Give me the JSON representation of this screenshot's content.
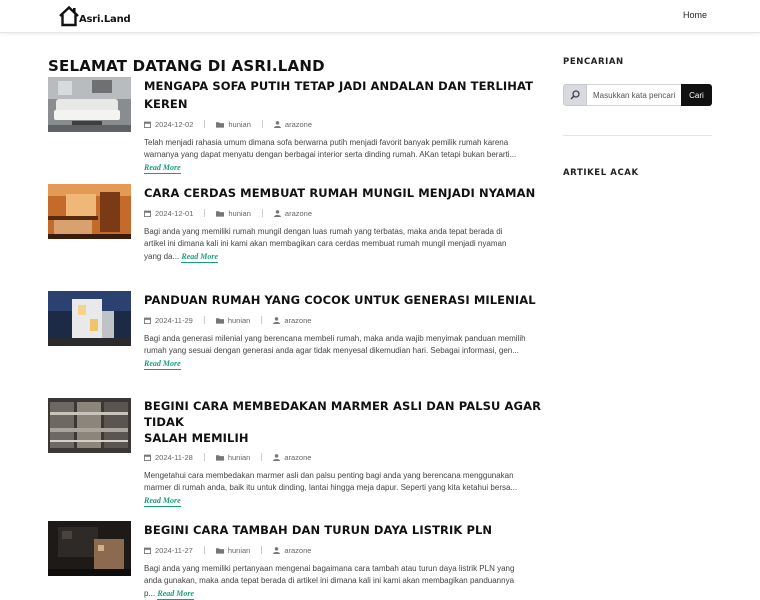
{
  "header": {
    "logo_text": "Asri.Land",
    "nav": {
      "home_label": "Home"
    }
  },
  "main": {
    "title": "SELAMAT DATANG DI ASRI.LAND",
    "read_more_label": "Read More",
    "posts": [
      {
        "title_lines": [
          "MENGAPA SOFA PUTIH TETAP JADI ANDALAN DAN TERLIHAT KEREN"
        ],
        "date": "2024-12-02",
        "category": "hunian",
        "author": "arazone",
        "excerpt_lines": [
          "Telah menjadi rahasia umum dimana sofa berwarna putih menjadi favorit banyak pemilik rumah karena",
          "warnanya yang dapat menyatu dengan berbagai interior serta dinding rumah. AKan tetapi bukan berarti..."
        ],
        "excerpt_tail": ""
      },
      {
        "title_lines": [
          "CARA CERDAS MEMBUAT RUMAH MUNGIL MENJADI NYAMAN"
        ],
        "date": "2024-12-01",
        "category": "hunian",
        "author": "arazone",
        "excerpt_lines": [
          "Bagi anda yang memiliki rumah mungil dengan luas rumah yang terbatas, maka anda tepat berada di",
          "artikel ini dimana kali ini kami akan membagikan cara cerdas membuat rumah mungil menjadi nyaman"
        ],
        "excerpt_tail": "yang da..."
      },
      {
        "title_lines": [
          "PANDUAN RUMAH YANG COCOK UNTUK GENERASI MILENIAL"
        ],
        "date": "2024-11-29",
        "category": "hunian",
        "author": "arazone",
        "excerpt_lines": [
          "Bagi anda generasi milenial yang berencana membeli rumah, maka anda wajib menyimak panduan memilih",
          "rumah yang sesuai dengan generasi anda agar tidak menyesal dikemudian hari. Sebagai informasi, gen..."
        ],
        "excerpt_tail": ""
      },
      {
        "title_lines": [
          "BEGINI CARA MEMBEDAKAN MARMER ASLI DAN PALSU AGAR TIDAK",
          "SALAH MEMILIH"
        ],
        "date": "2024-11-28",
        "category": "hunian",
        "author": "arazone",
        "excerpt_lines": [
          "Mengetahui cara membedakan marmer asli dan palsu penting bagi anda yang berencana menggunakan",
          "marmer di rumah anda, baik itu untuk dinding, lantai hingga meja dapur. Seperti yang kita ketahui bersa..."
        ],
        "excerpt_tail": ""
      },
      {
        "title_lines": [
          "BEGINI CARA TAMBAH DAN TURUN DAYA LISTRIK PLN"
        ],
        "date": "2024-11-27",
        "category": "hunian",
        "author": "arazone",
        "excerpt_lines": [
          "Bagi anda yang memiliki pertanyaan mengenai bagaimana cara tambah atau turun daya listrik PLN yang",
          "anda gunakan, maka anda tepat berada di artikel ini dimana kali ini kami akan membagikan panduannya"
        ],
        "excerpt_tail": "p..."
      }
    ]
  },
  "sidebar": {
    "search_heading": "PENCARIAN",
    "search_placeholder": "Masukkan kata pencarian",
    "search_button": "Cari",
    "random_heading": "ARTIKEL ACAK"
  },
  "icons": {
    "logo": "house-logo-icon",
    "date": "calendar-icon",
    "category": "folder-icon",
    "author": "user-icon",
    "search": "search-icon"
  },
  "colors": {
    "accent": "#1a9e7a",
    "search_button": "#111111"
  }
}
